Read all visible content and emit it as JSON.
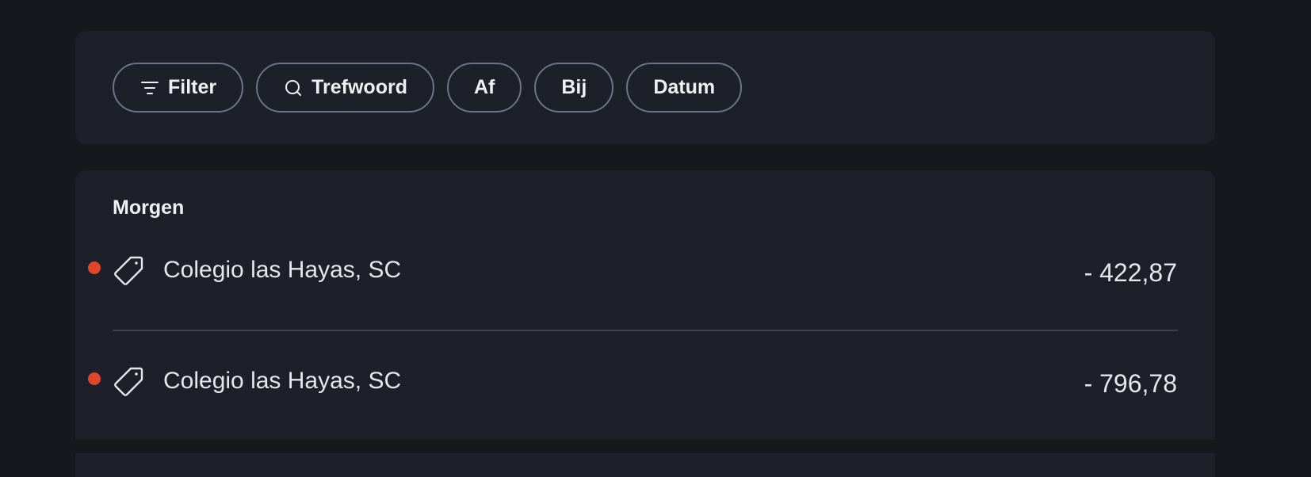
{
  "filters": [
    {
      "label": "Filter",
      "icon": "filter-icon"
    },
    {
      "label": "Trefwoord",
      "icon": "search-icon"
    },
    {
      "label": "Af"
    },
    {
      "label": "Bij"
    },
    {
      "label": "Datum"
    }
  ],
  "section": {
    "title": "Morgen",
    "transactions": [
      {
        "name": "Colegio las Hayas, SC",
        "amount": "- 422,87",
        "icon": "tag-icon",
        "status_color": "#e2462a"
      },
      {
        "name": "Colegio las Hayas, SC",
        "amount": "- 796,78",
        "icon": "tag-icon",
        "status_color": "#e2462a"
      }
    ]
  }
}
